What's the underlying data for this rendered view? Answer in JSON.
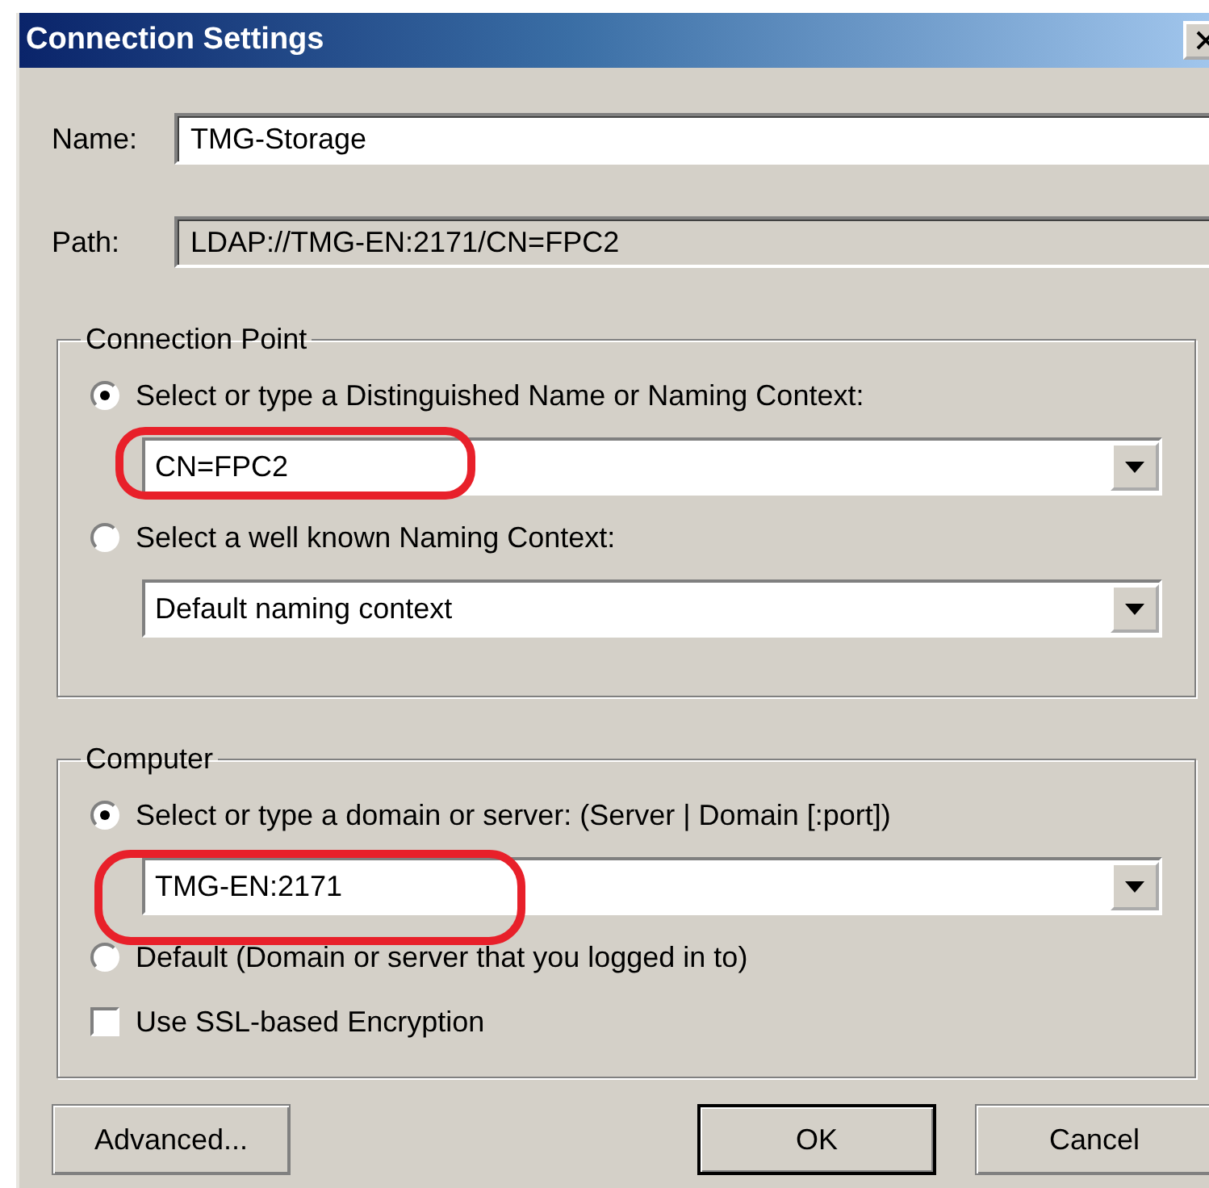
{
  "window": {
    "title": "Connection Settings"
  },
  "fields": [
    {
      "label": "Name:",
      "value": "TMG-Storage",
      "disabled": false
    },
    {
      "label": "Path:",
      "value": "LDAP://TMG-EN:2171/CN=FPC2",
      "disabled": true
    }
  ],
  "groups": [
    {
      "title": "Connection Point",
      "options": [
        {
          "kind": "radio",
          "label": "Select or type a Distinguished Name or Naming Context:",
          "selected": true,
          "combo": "CN=FPC2"
        },
        {
          "kind": "radio",
          "label": "Select a well known Naming Context:",
          "selected": false,
          "combo": "Default naming context"
        }
      ]
    },
    {
      "title": "Computer",
      "options": [
        {
          "kind": "radio",
          "label": "Select or type a domain or server: (Server | Domain [:port])",
          "selected": true,
          "combo": "TMG-EN:2171"
        },
        {
          "kind": "radio",
          "label": "Default (Domain or server that you logged in to)",
          "selected": false
        },
        {
          "kind": "checkbox",
          "label": "Use SSL-based Encryption",
          "checked": false
        }
      ]
    }
  ],
  "buttons": [
    {
      "label": "Advanced...",
      "default": false
    },
    {
      "label": "OK",
      "default": true
    },
    {
      "label": "Cancel",
      "default": false
    }
  ]
}
